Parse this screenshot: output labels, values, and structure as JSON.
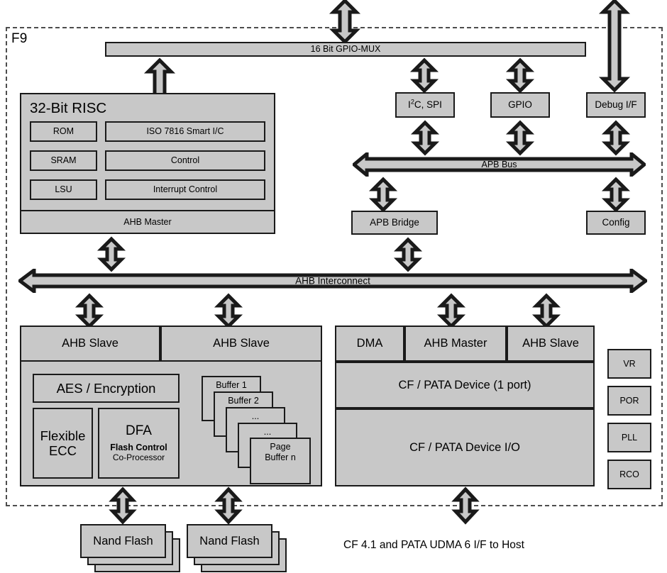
{
  "diagram": {
    "chip_label": "F9",
    "footer_note": "CF 4.1 and PATA UDMA 6 I/F to Host"
  },
  "buses": {
    "gpio_mux": "16 Bit GPIO-MUX",
    "apb_bus": "APB Bus",
    "ahb_interconnect": "AHB Interconnect"
  },
  "risc": {
    "title": "32-Bit RISC",
    "rom": "ROM",
    "sram": "SRAM",
    "lsu": "LSU",
    "iso": "ISO 7816  Smart I/C",
    "control": "Control",
    "interrupt": "Interrupt Control",
    "ahb_master": "AHB Master"
  },
  "peripherals": {
    "i2c_spi_pre": "I",
    "i2c_spi_sup": "2",
    "i2c_spi_post": "C, SPI",
    "gpio": "GPIO",
    "debug": "Debug I/F",
    "apb_bridge": "APB Bridge",
    "config": "Config"
  },
  "flash_block": {
    "ahb_slave_left": "AHB Slave",
    "ahb_slave_right": "AHB Slave",
    "aes": "AES / Encryption",
    "ecc": "Flexible\nECC",
    "ecc_line1": "Flexible",
    "ecc_line2": "ECC",
    "dfa_title": "DFA",
    "dfa_sub1": "Flash Control",
    "dfa_sub2": "Co-Processor",
    "buffers": [
      "Buffer 1",
      "Buffer 2",
      "...",
      "...",
      "Page\nBuffer n"
    ],
    "buffer_last_line1": "Page",
    "buffer_last_line2": "Buffer n"
  },
  "cf_block": {
    "dma": "DMA",
    "ahb_master": "AHB Master",
    "ahb_slave": "AHB Slave",
    "device": "CF / PATA Device (1 port)",
    "device_io": "CF / PATA Device I/O"
  },
  "analog": {
    "vr": "VR",
    "por": "POR",
    "pll": "PLL",
    "rco": "RCO"
  },
  "memory": {
    "nand_left": "Nand Flash",
    "nand_right": "Nand Flash"
  },
  "colors": {
    "fill": "#c8c8c8",
    "stroke": "#1a1a1a",
    "dashed": "#4d4d4d",
    "background": "#ffffff"
  }
}
